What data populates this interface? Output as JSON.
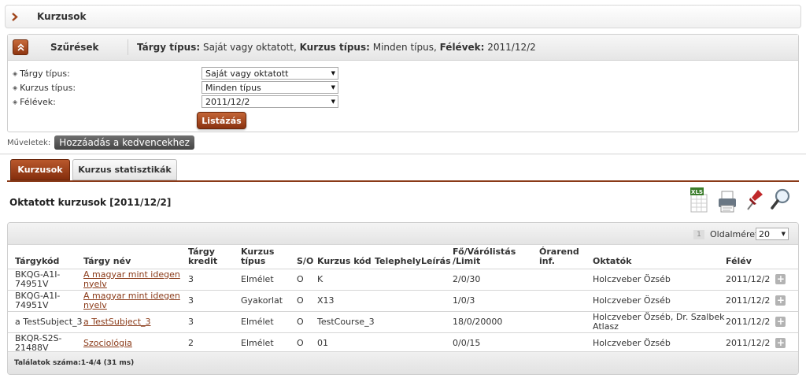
{
  "header": {
    "title": "Kurzusok",
    "icon": "chevron-right-icon"
  },
  "filters": {
    "label": "Szűrések",
    "summary": [
      {
        "key": "Tárgy típus:",
        "value": " Saját vagy oktatott, "
      },
      {
        "key": "Kurzus típus:",
        "value": " Minden típus, "
      },
      {
        "key": "Félévek:",
        "value": " 2011/12/2"
      }
    ],
    "rows": [
      {
        "label": "Tárgy típus:",
        "value": "Saját vagy oktatott"
      },
      {
        "label": "Kurzus típus:",
        "value": "Minden típus"
      },
      {
        "label": "Félévek:",
        "value": "2011/12/2"
      }
    ],
    "list_button": "Listázás"
  },
  "operations": {
    "label": "Műveletek:",
    "favorite_button": "Hozzáadás a kedvencekhez"
  },
  "tabs": [
    {
      "label": "Kurzusok",
      "active": true
    },
    {
      "label": "Kurzus statisztikák",
      "active": false
    }
  ],
  "section_title": "Oktatott kurzusok [2011/12/2]",
  "toolbar": {
    "icons": [
      "excel-export-icon",
      "print-icon",
      "pin-icon",
      "search-icon"
    ]
  },
  "pagination": {
    "current_page": "1",
    "page_size_label": "Oldalméret",
    "page_size": "20"
  },
  "table": {
    "columns": [
      "Tárgykód",
      "Tárgy név",
      "Tárgy kredit",
      "Kurzus típus",
      "S/O",
      "Kurzus kód",
      "Telephely",
      "Leírás",
      "Fő/Várólistás /Limit",
      "Órarend inf.",
      "Oktatók",
      "Félév"
    ],
    "rows": [
      {
        "code": "BKQG-A1I-74951V",
        "name": "A magyar mint idegen nyelv",
        "credit": "3",
        "type": "Elmélet",
        "so": "O",
        "course_code": "K",
        "site": "",
        "desc": "",
        "limit": "2/0/30",
        "timetable": "",
        "teachers": "Holczveber Özséb",
        "semester": "2011/12/2"
      },
      {
        "code": "BKQG-A1I-74951V",
        "name": "A magyar mint idegen nyelv",
        "credit": "3",
        "type": "Gyakorlat",
        "so": "O",
        "course_code": "X13",
        "site": "",
        "desc": "",
        "limit": "1/0/3",
        "timetable": "",
        "teachers": "Holczveber Özséb",
        "semester": "2011/12/2"
      },
      {
        "code": "a TestSubject_3",
        "name": "a TestSubject_3",
        "credit": "3",
        "type": "Elmélet",
        "so": "O",
        "course_code": "TestCourse_3",
        "site": "",
        "desc": "",
        "limit": "18/0/20000",
        "timetable": "",
        "teachers": "Holczveber Özséb, Dr. Szalbek Atlasz",
        "semester": "2011/12/2"
      },
      {
        "code": "BKQR-S2S-21488V",
        "name": "Szociológia",
        "credit": "2",
        "type": "Elmélet",
        "so": "O",
        "course_code": "01",
        "site": "",
        "desc": "",
        "limit": "0/0/15",
        "timetable": "",
        "teachers": "Holczveber Özséb",
        "semester": "2011/12/2"
      }
    ]
  },
  "footer": {
    "result_count": "Találatok száma:1-4/4 (31 ms)"
  },
  "colors": {
    "accent": "#8a3a18",
    "accent_light": "#c36537"
  }
}
